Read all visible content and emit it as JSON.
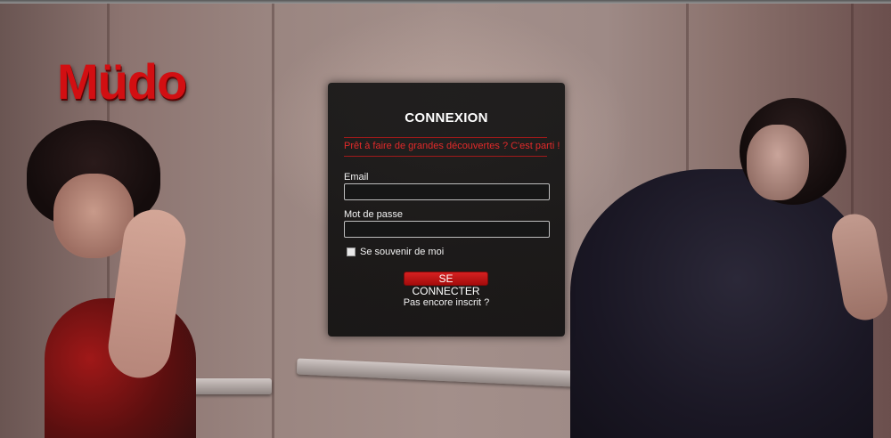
{
  "brand": {
    "logo_text": "Müdo",
    "accent_color": "#d20f12"
  },
  "login": {
    "title": "CONNEXION",
    "tagline": "Prêt à faire de grandes découvertes ? C'est parti !",
    "email_label": "Email",
    "email_value": "",
    "password_label": "Mot de passe",
    "password_value": "",
    "remember_label": "Se souvenir de moi",
    "remember_checked": false,
    "submit_label": "SE CONNECTER",
    "signup_link": "Pas encore inscrit ?"
  }
}
